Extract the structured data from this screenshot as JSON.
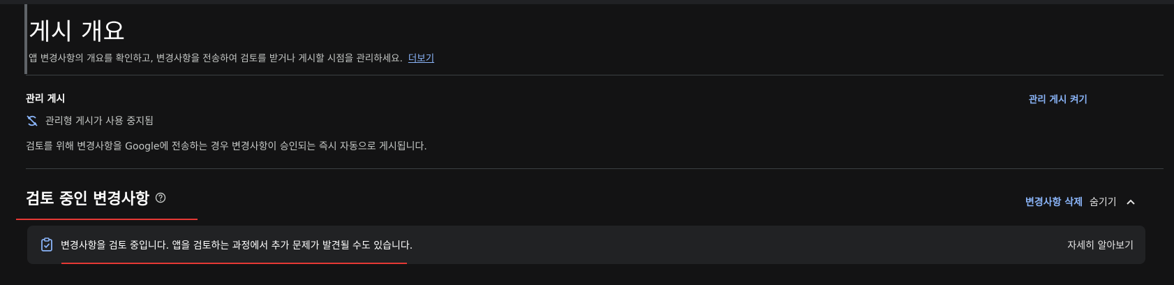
{
  "header": {
    "title": "게시 개요",
    "description": "앱 변경사항의 개요를 확인하고, 변경사항을 전송하여 검토를 받거나 게시할 시점을 관리하세요.",
    "learn_more_link": "더보기"
  },
  "managed_publishing": {
    "label": "관리 게시",
    "toggle_link": "관리 게시 켜기",
    "status_icon": "sync-disabled-icon",
    "status_text": "관리형 게시가 사용 중지됨",
    "description": "검토를 위해 변경사항을 Google에 전송하는 경우 변경사항이 승인되는 즉시 자동으로 게시됩니다."
  },
  "review_section": {
    "title": "검토 중인 변경사항",
    "help_icon": "help-circle-icon",
    "delete_changes": "변경사항 삭제",
    "hide_label": "숨기기",
    "collapse_icon": "chevron-up-icon",
    "notice": {
      "icon": "clipboard-check-icon",
      "text": "변경사항을 검토 중입니다. 앱을 검토하는 과정에서 추가 문제가 발견될 수도 있습니다.",
      "learn_more": "자세히 알아보기"
    }
  },
  "colors": {
    "background": "#131314",
    "notice_background": "#212224",
    "link_blue": "#8ab4f8",
    "annotation_red": "#e53935"
  }
}
